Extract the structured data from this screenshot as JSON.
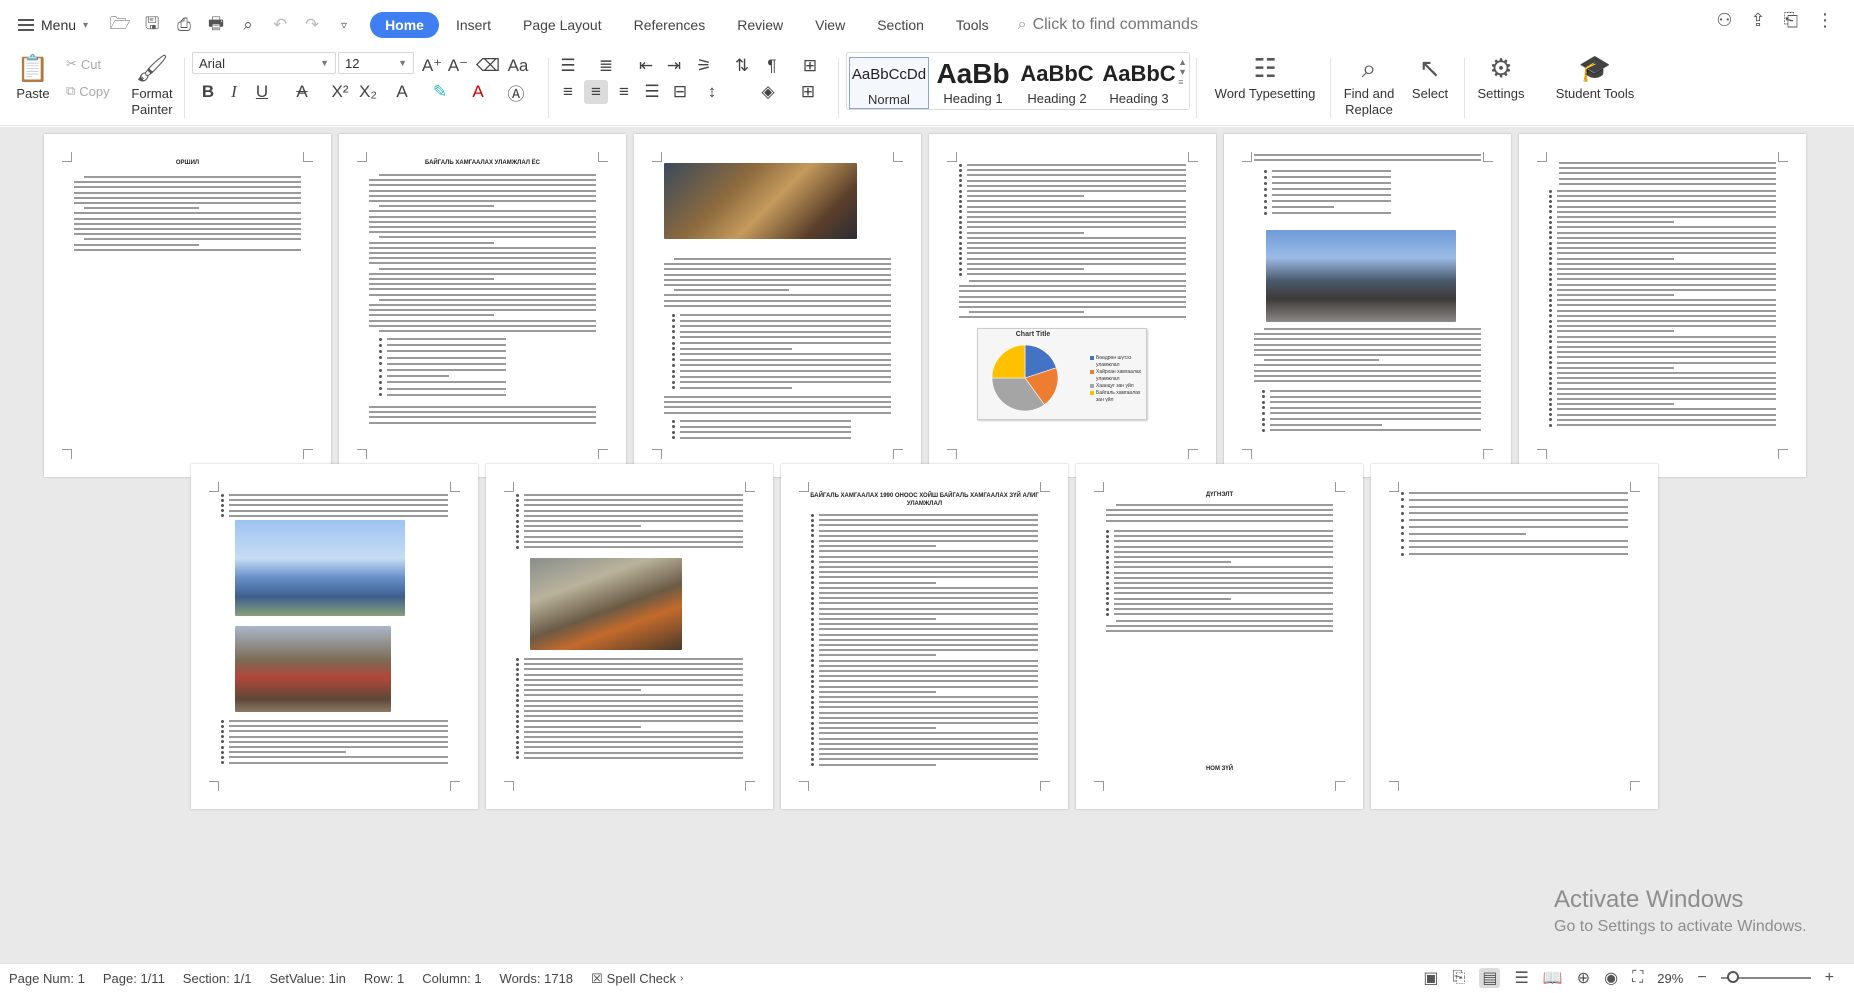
{
  "menubar": {
    "menu_label": "Menu",
    "tabs": [
      {
        "label": "Home",
        "active": true
      },
      {
        "label": "Insert"
      },
      {
        "label": "Page Layout"
      },
      {
        "label": "References"
      },
      {
        "label": "Review"
      },
      {
        "label": "View"
      },
      {
        "label": "Section"
      },
      {
        "label": "Tools"
      }
    ],
    "command_search_placeholder": "Click to find commands"
  },
  "ribbon": {
    "paste": "Paste",
    "cut": "Cut",
    "copy": "Copy",
    "format_painter": "Format Painter",
    "font_name": "Arial",
    "font_size": "12",
    "styles": [
      {
        "sample": "AaBbCcDd",
        "name": "Normal"
      },
      {
        "sample": "AaBb",
        "name": "Heading 1"
      },
      {
        "sample": "AaBbC",
        "name": "Heading 2"
      },
      {
        "sample": "AaBbC",
        "name": "Heading 3"
      }
    ],
    "word_typesetting": "Word Typesetting",
    "find_and_replace": "Find and Replace",
    "select": "Select",
    "settings": "Settings",
    "student_tools": "Student Tools"
  },
  "document": {
    "page1_heading": "ОРШИЛ",
    "page2_heading": "БАЙГАЛЬ ХАМГААЛАХ УЛАМЖЛАЛ ЁС",
    "page4_chart": {
      "title": "Chart Title",
      "legend": [
        "Бөөдрөн шүтээ уламжлал",
        "Хайрхан хамгаалах уламжлал",
        "Хаанцуг зан үйл",
        "Байгаль хамгаалах зан үйл"
      ],
      "colors": [
        "#4472c4",
        "#ed7d31",
        "#a5a5a5",
        "#ffc000"
      ],
      "values": [
        20,
        20,
        35,
        25
      ]
    },
    "page9_heading": "БАЙГАЛЬ ХАМГААЛАХ 1990 ОНООС ХОЙШ БАЙГАЛЬ ХАМГААЛАХ ЗҮЙ АЛИГ УЛАМЖЛАЛ",
    "page10_heading": "ДҮГНЭЛТ",
    "page10_footer": "НОМ ЗҮЙ"
  },
  "watermark": {
    "line1": "Activate Windows",
    "line2": "Go to Settings to activate Windows."
  },
  "statusbar": {
    "page_num": "Page Num: 1",
    "page": "Page: 1/11",
    "section": "Section: 1/1",
    "set_value": "SetValue: 1in",
    "row": "Row: 1",
    "column": "Column: 1",
    "words": "Words: 1718",
    "spell_check": "Spell Check",
    "zoom": "29%"
  }
}
